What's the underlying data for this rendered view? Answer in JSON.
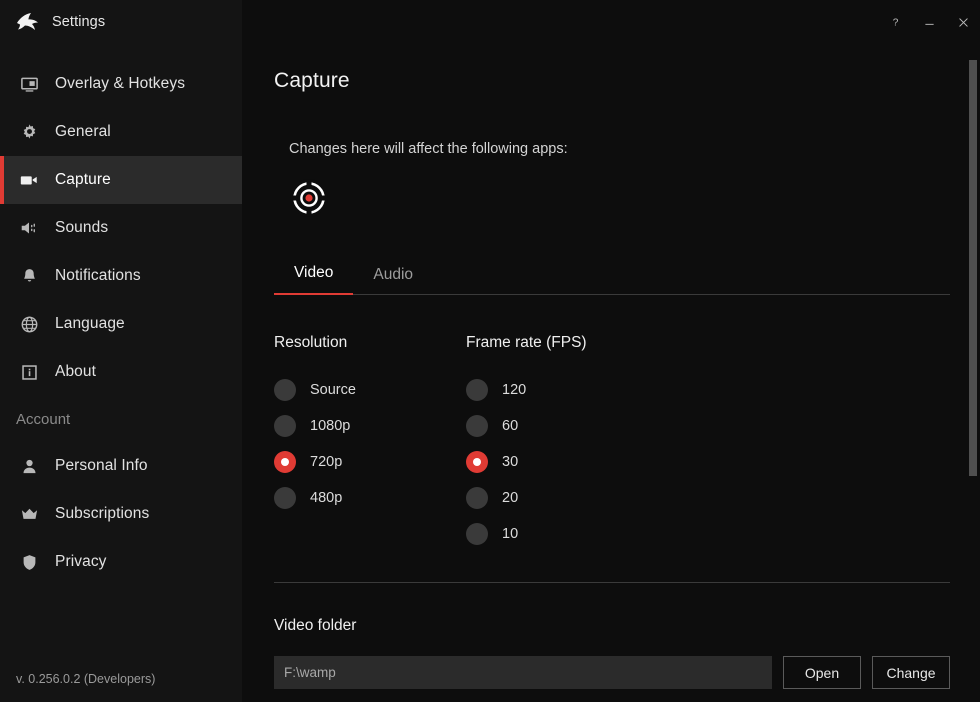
{
  "window": {
    "title": "Settings",
    "logo_icon": "shark-logo-icon",
    "help_label": "?",
    "minimize_label": "–",
    "close_label": "×",
    "help_icon": "help-icon",
    "minimize_icon": "minimize-icon",
    "close_icon": "close-icon"
  },
  "sidebar": {
    "items": [
      {
        "label": "Overlay & Hotkeys",
        "icon": "overlay-monitor-icon",
        "active": false
      },
      {
        "label": "General",
        "icon": "gear-icon",
        "active": false
      },
      {
        "label": "Capture",
        "icon": "video-camera-icon",
        "active": true
      },
      {
        "label": "Sounds",
        "icon": "speaker-icon",
        "active": false
      },
      {
        "label": "Notifications",
        "icon": "bell-icon",
        "active": false
      },
      {
        "label": "Language",
        "icon": "globe-icon",
        "active": false
      },
      {
        "label": "About",
        "icon": "info-icon",
        "active": false
      }
    ],
    "section_label": "Account",
    "account_items": [
      {
        "label": "Personal Info",
        "icon": "person-icon",
        "active": false
      },
      {
        "label": "Subscriptions",
        "icon": "crown-icon",
        "active": false
      },
      {
        "label": "Privacy",
        "icon": "shield-icon",
        "active": false
      }
    ],
    "version": "v. 0.256.0.2 (Developers)"
  },
  "main": {
    "page_title": "Capture",
    "affect_note": "Changes here will affect the following apps:",
    "apps": [
      {
        "name": "target-crosshair-app-icon"
      }
    ],
    "tabs": [
      {
        "label": "Video",
        "active": true
      },
      {
        "label": "Audio",
        "active": false
      }
    ],
    "resolution": {
      "title": "Resolution",
      "options": [
        {
          "label": "Source",
          "selected": false
        },
        {
          "label": "1080p",
          "selected": false
        },
        {
          "label": "720p",
          "selected": true
        },
        {
          "label": "480p",
          "selected": false
        }
      ]
    },
    "framerate": {
      "title": "Frame rate (FPS)",
      "options": [
        {
          "label": "120",
          "selected": false
        },
        {
          "label": "60",
          "selected": false
        },
        {
          "label": "30",
          "selected": true
        },
        {
          "label": "20",
          "selected": false
        },
        {
          "label": "10",
          "selected": false
        }
      ]
    },
    "video_folder": {
      "title": "Video folder",
      "path": "F:\\wamp",
      "open_label": "Open",
      "change_label": "Change"
    }
  },
  "colors": {
    "accent_red": "#e03b34",
    "sidebar_bg": "#141414",
    "content_bg": "#0d0d0d",
    "active_item_bg": "#2b2b2b"
  }
}
